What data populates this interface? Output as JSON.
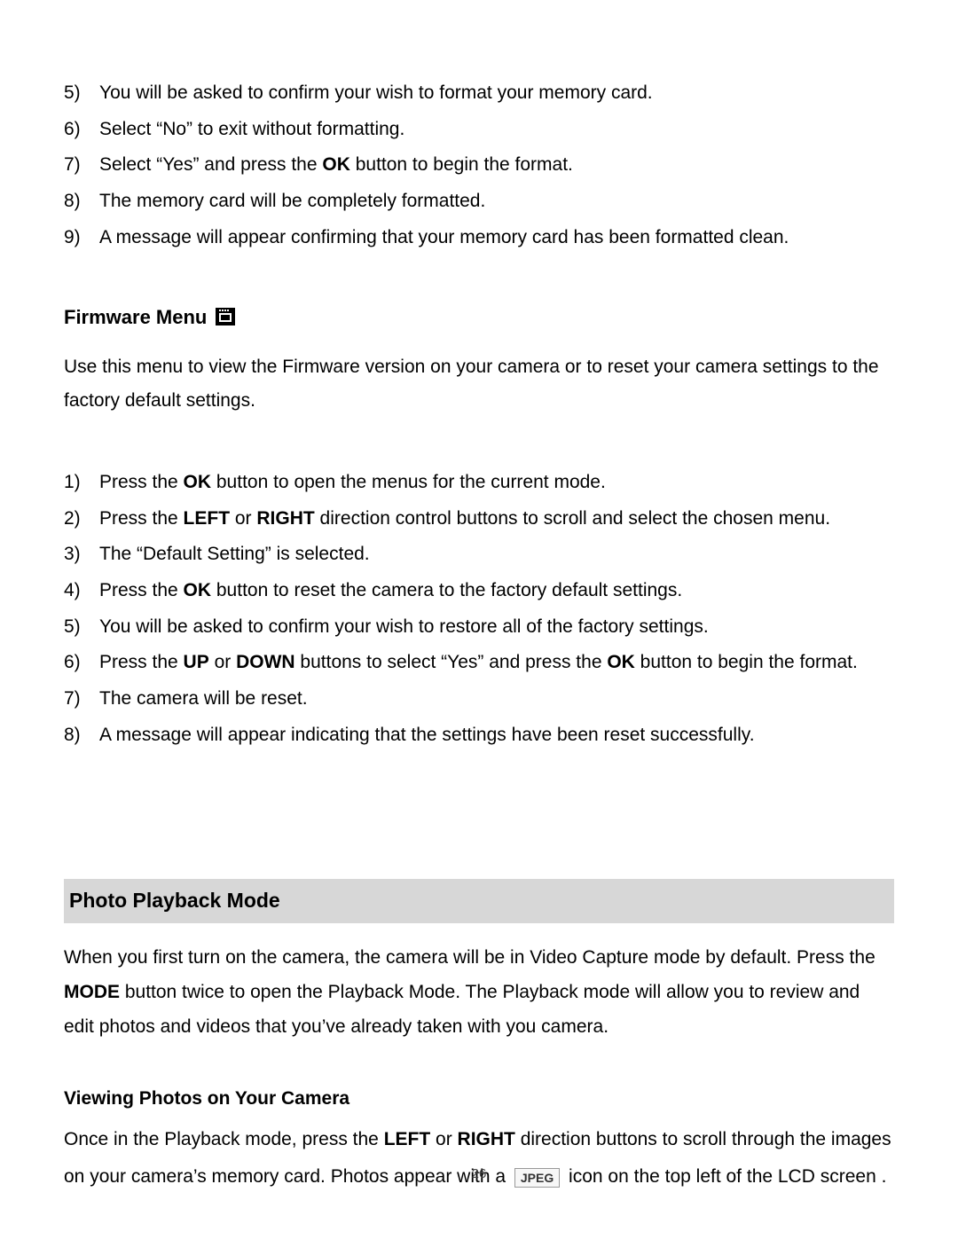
{
  "list1": {
    "start": 5,
    "items": [
      "You will be asked to confirm your wish to format your memory card.",
      "Select “No” to exit without formatting.",
      {
        "pre": "Select “Yes” and press the ",
        "b": "OK",
        "post": " button to begin the format."
      },
      "The memory card will be completely formatted.",
      "A message will appear confirming that your memory card has been formatted clean."
    ]
  },
  "firmware": {
    "heading": "Firmware Menu",
    "intro": "Use this menu to view the Firmware version on your camera or to reset your camera settings to the factory default settings.",
    "list_start": 1,
    "items": [
      {
        "segments": [
          {
            "t": "Press the "
          },
          {
            "t": "OK",
            "b": true
          },
          {
            "t": " button to open the menus for the current mode."
          }
        ]
      },
      {
        "segments": [
          {
            "t": "Press the "
          },
          {
            "t": "LEFT",
            "b": true
          },
          {
            "t": " or "
          },
          {
            "t": "RIGHT",
            "b": true
          },
          {
            "t": " direction control buttons to scroll and select the chosen menu."
          }
        ]
      },
      {
        "text": "The “Default Setting” is selected."
      },
      {
        "segments": [
          {
            "t": "Press the "
          },
          {
            "t": "OK",
            "b": true
          },
          {
            "t": " button to reset the camera to the factory default settings."
          }
        ]
      },
      {
        "text": "You will be asked to confirm your wish to restore all of the factory settings."
      },
      {
        "segments": [
          {
            "t": "Press the "
          },
          {
            "t": "UP",
            "b": true
          },
          {
            "t": " or "
          },
          {
            "t": "DOWN",
            "b": true
          },
          {
            "t": " buttons to select “Yes” and press the "
          },
          {
            "t": "OK",
            "b": true
          },
          {
            "t": " button to begin the format."
          }
        ]
      },
      {
        "text": "The camera will be reset."
      },
      {
        "text": "A message will appear indicating that the settings have been reset successfully."
      }
    ]
  },
  "playback": {
    "heading": "Photo Playback Mode",
    "intro_segments": [
      {
        "t": "When you first turn on the camera, the camera will be in Video Capture mode by default. Press the "
      },
      {
        "t": "MODE",
        "b": true
      },
      {
        "t": " button twice to open the Playback Mode. The Playback mode will allow you to review and edit photos and videos that you’ve already taken with you camera."
      }
    ]
  },
  "viewing": {
    "heading": "Viewing Photos on Your Camera",
    "segments_before": [
      {
        "t": "Once in the Playback mode, press the "
      },
      {
        "t": "LEFT",
        "b": true
      },
      {
        "t": " or "
      },
      {
        "t": "RIGHT",
        "b": true
      },
      {
        "t": " direction buttons to scroll through the images on your camera’s memory card. Photos appear with a "
      }
    ],
    "jpeg_label": "JPEG",
    "segments_after": [
      {
        "t": " icon on the top left of the LCD screen ."
      }
    ]
  },
  "page_number": "26"
}
